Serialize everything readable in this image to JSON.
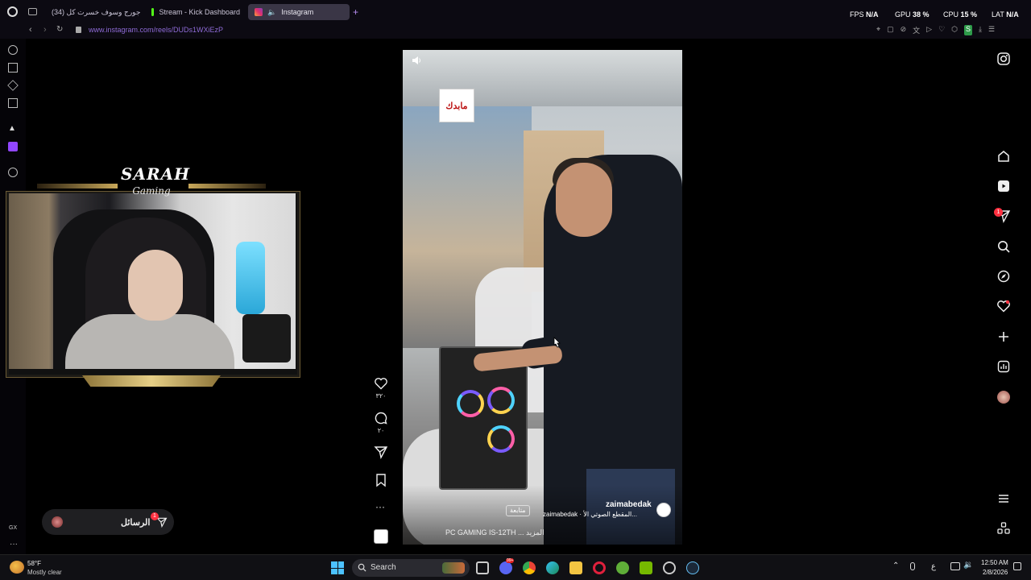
{
  "tabs": [
    {
      "label": "جورج وسوف خسرت كل (34)",
      "favicon": "youtube-icon",
      "color": "#ff0000"
    },
    {
      "label": "Stream - Kick Dashboard",
      "favicon": "kick-icon",
      "color": "#53fc18"
    },
    {
      "label": "Instagram",
      "favicon": "instagram-icon",
      "color": "#e1306c",
      "active": true
    }
  ],
  "address_bar": {
    "url": "www.instagram.com/reels/DUDs1WXiEzP"
  },
  "stats": {
    "fps_label": "FPS",
    "fps_value": "N/A",
    "gpu_label": "GPU",
    "gpu_value": "38 %",
    "cpu_label": "CPU",
    "cpu_value": "15 %",
    "lat_label": "LAT",
    "lat_value": "N/A"
  },
  "stream_overlay": {
    "logo_title": "SARAH",
    "logo_sub": "Gaming"
  },
  "reel": {
    "store_logo": "مابدك",
    "username": "zaimabedak",
    "audio_line": "zaimabedak · المقطع الصوتي الأ...",
    "follow_label": "متابعة",
    "caption": "PC GAMING IS-12TH ... المزيد",
    "likes": "٣٢٠",
    "comments": "٢٠"
  },
  "messages": {
    "label": "الرسائل",
    "badge": "1"
  },
  "right_nav": {
    "notifications_badge": "1"
  },
  "taskbar": {
    "weather_temp": "58°F",
    "weather_desc": "Mostly clear",
    "search_label": "Search",
    "time": "12:50 AM",
    "date": "2/8/2026",
    "lang": "ع",
    "discord_badge": "99+"
  },
  "sidebar": {
    "bottom_label": "GX"
  },
  "colors": {
    "accent": "#8e6bd6",
    "bg": "#000000",
    "tab_active": "#3a3646"
  }
}
